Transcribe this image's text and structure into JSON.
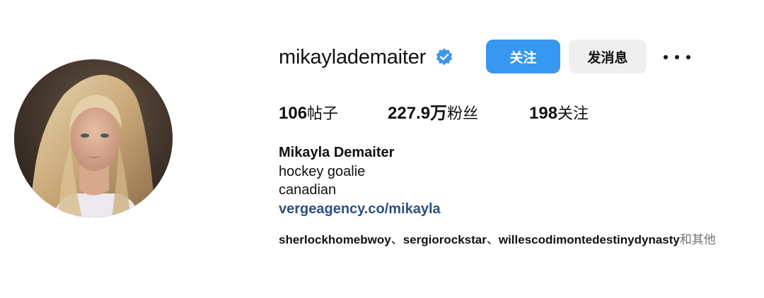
{
  "profile": {
    "username": "mikaylademaiter",
    "verified": true,
    "verified_icon": "verified-badge-icon",
    "accent_color": "#3897f0",
    "link_color": "#2e4f7e"
  },
  "actions": {
    "follow_label": "关注",
    "message_label": "发消息",
    "more_icon": "more-horizontal-icon"
  },
  "stats": {
    "posts": {
      "value": "106",
      "label": "帖子"
    },
    "followers": {
      "value": "227.9万",
      "label": "粉丝"
    },
    "following": {
      "value": "198",
      "label": "关注"
    }
  },
  "bio": {
    "full_name": "Mikayla Demaiter",
    "lines": [
      "hockey goalie",
      "canadian"
    ],
    "link": "vergeagency.co/mikayla"
  },
  "followed_by": {
    "users": [
      "sherlockhomebwoy",
      "sergiorockstar",
      "willescodimontedestinydynasty"
    ],
    "separator": "、",
    "suffix": "和其他"
  }
}
